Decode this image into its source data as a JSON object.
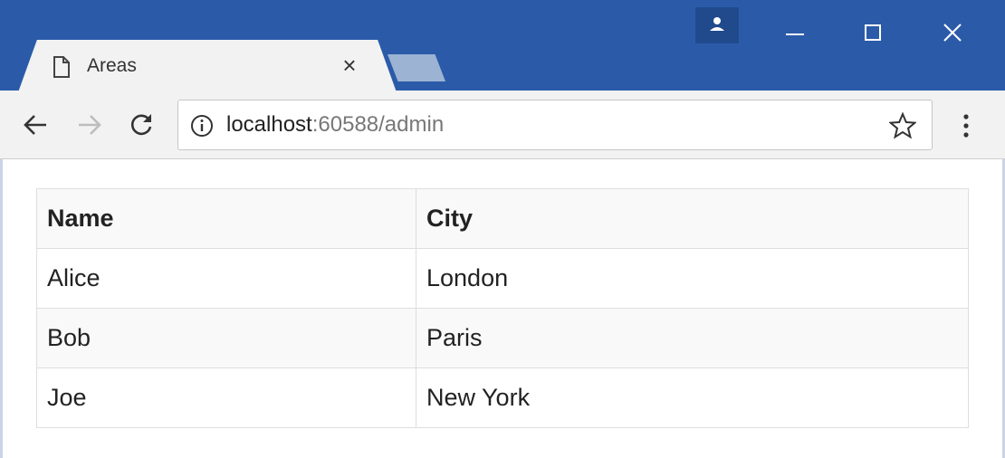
{
  "browser": {
    "tab_title": "Areas",
    "tab_close_glyph": "×",
    "url_host": "localhost",
    "url_rest": ":60588/admin",
    "icons": {
      "tab": "page-icon",
      "back": "back-arrow-icon",
      "forward": "forward-arrow-icon",
      "reload": "reload-icon",
      "info": "info-icon",
      "bookmark": "star-icon",
      "menu": "kebab-menu-icon",
      "profile": "profile-icon",
      "minimize": "minimize-icon",
      "maximize": "maximize-icon",
      "close": "close-icon"
    },
    "colors": {
      "titlebar": "#2b5ba8",
      "toolbar": "#f2f2f2",
      "inactive_tab": "#9db3d4"
    }
  },
  "table": {
    "headers": [
      "Name",
      "City"
    ],
    "rows": [
      [
        "Alice",
        "London"
      ],
      [
        "Bob",
        "Paris"
      ],
      [
        "Joe",
        "New York"
      ]
    ]
  }
}
